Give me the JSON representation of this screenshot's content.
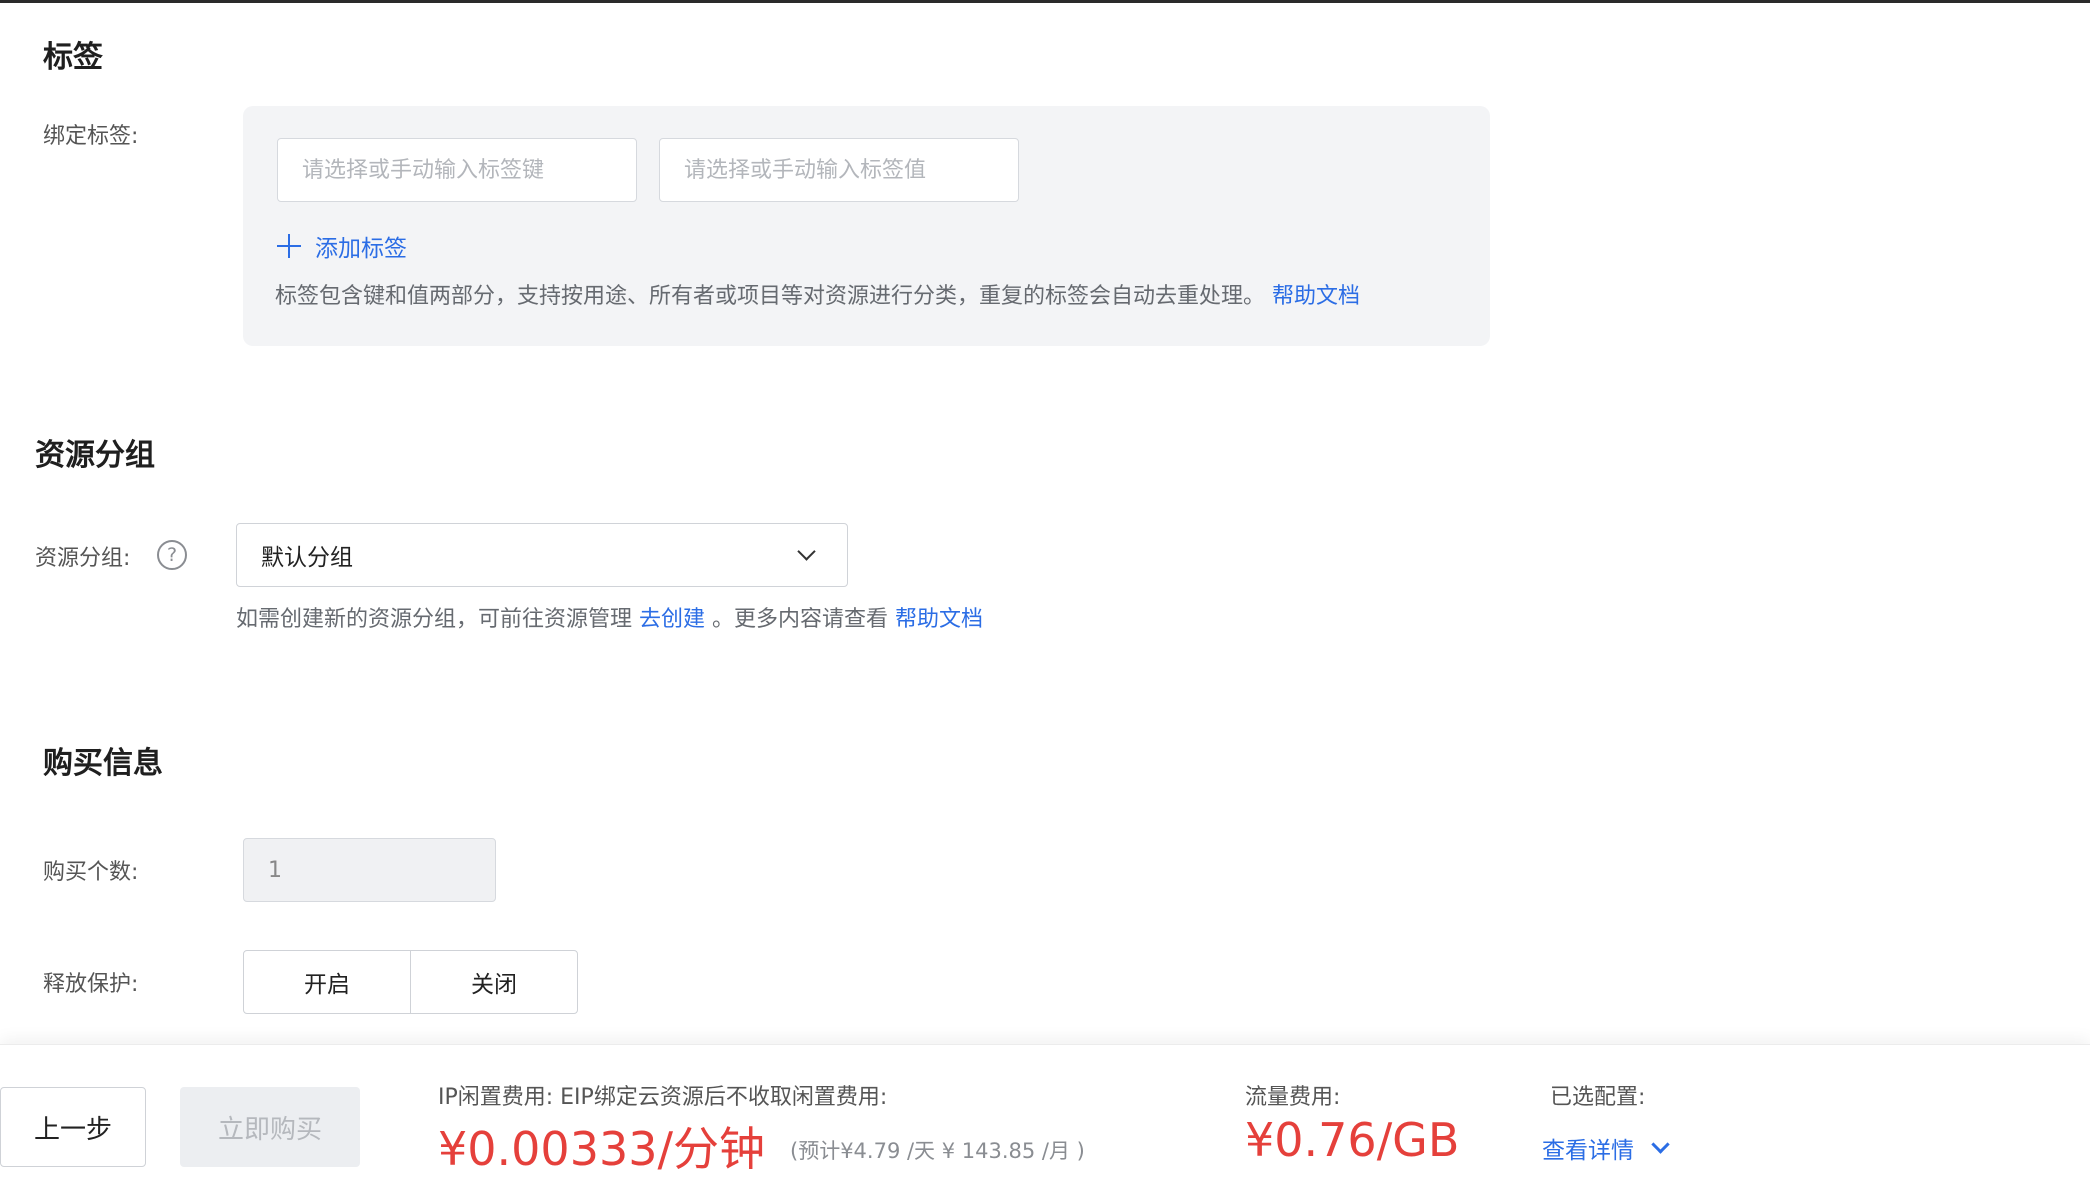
{
  "tags": {
    "title": "标签",
    "bind_label": "绑定标签:",
    "key_placeholder": "请选择或手动输入标签键",
    "value_placeholder": "请选择或手动输入标签值",
    "add_tag_label": "添加标签",
    "description": "标签包含键和值两部分，支持按用途、所有者或项目等对资源进行分类，重复的标签会自动去重处理。",
    "help_link": "帮助文档"
  },
  "resource_group": {
    "title": "资源分组",
    "label": "资源分组:",
    "help_icon": "?",
    "selected": "默认分组",
    "hint_prefix": "如需创建新的资源分组，可前往资源管理",
    "create_link": "去创建",
    "hint_middle": "。更多内容请查看",
    "help_link": "帮助文档"
  },
  "purchase": {
    "title": "购买信息",
    "quantity_label": "购买个数:",
    "quantity_value": "1",
    "release_protection_label": "释放保护:",
    "options": [
      "开启",
      "关闭"
    ]
  },
  "footer": {
    "prev_button": "上一步",
    "buy_button": "立即购买",
    "idle_fee_label": "IP闲置费用: EIP绑定云资源后不收取闲置费用:",
    "idle_fee_price": "¥0.00333/分钟",
    "idle_fee_estimate": "(预计¥4.79 /天 ¥ 143.85 /月 )",
    "traffic_fee_label": "流量费用:",
    "traffic_fee_price": "¥0.76/GB",
    "selected_config_label": "已选配置:",
    "detail_link": "查看详情"
  },
  "colors": {
    "accent": "#2b6de5",
    "price": "#e5403b",
    "panel_bg": "#f3f4f6"
  },
  "icons": [
    "plus-icon",
    "help-circle-icon",
    "chevron-down-icon"
  ]
}
